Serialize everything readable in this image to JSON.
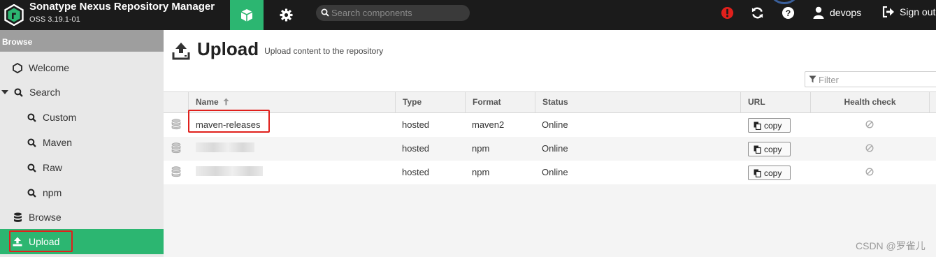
{
  "header": {
    "app_title": "Sonatype Nexus Repository Manager",
    "app_version": "OSS 3.19.1-01",
    "search_placeholder": "Search components",
    "user_name": "devops",
    "signout_label": "Sign out",
    "nav_browse_icon": "cube-icon",
    "nav_admin_icon": "gear-icon",
    "alert_color": "#e0201c"
  },
  "sidebar": {
    "section_label": "Browse",
    "items": [
      {
        "label": "Welcome",
        "icon": "hexagon-icon"
      },
      {
        "label": "Search",
        "icon": "search-icon"
      },
      {
        "label": "Custom",
        "icon": "search-icon"
      },
      {
        "label": "Maven",
        "icon": "search-icon"
      },
      {
        "label": "Raw",
        "icon": "search-icon"
      },
      {
        "label": "npm",
        "icon": "search-icon"
      },
      {
        "label": "Browse",
        "icon": "database-icon"
      },
      {
        "label": "Upload",
        "icon": "upload-icon"
      }
    ],
    "active_color": "#2cb671"
  },
  "main": {
    "title": "Upload",
    "subtitle": "Upload content to the repository",
    "filter_placeholder": "Filter",
    "columns": {
      "name": "Name",
      "type": "Type",
      "format": "Format",
      "status": "Status",
      "url": "URL",
      "health": "Health check"
    },
    "rows": [
      {
        "name": "maven-releases",
        "type": "hosted",
        "format": "maven2",
        "status": "Online",
        "copy": "copy"
      },
      {
        "name": "",
        "type": "hosted",
        "format": "npm",
        "status": "Online",
        "copy": "copy"
      },
      {
        "name": "",
        "type": "hosted",
        "format": "npm",
        "status": "Online",
        "copy": "copy"
      }
    ]
  },
  "watermark": "CSDN @罗雀儿"
}
